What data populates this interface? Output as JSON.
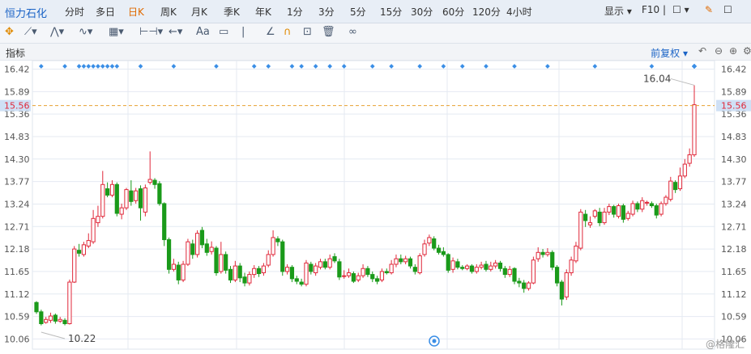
{
  "header": {
    "stock_name": "恒力石化",
    "periods": [
      "分时",
      "多日",
      "日K",
      "周K",
      "月K",
      "季K",
      "年K",
      "1分",
      "3分",
      "5分",
      "15分",
      "30分",
      "60分",
      "120分",
      "4小时"
    ],
    "active_period": "日K",
    "display_label": "显示",
    "f10_label": "F10"
  },
  "indicator_bar": {
    "label": "指标",
    "restore_label": "前复权"
  },
  "watermark": "@格隆汇",
  "colors": {
    "up": "#e0283a",
    "down": "#1a9a1a",
    "grid": "#e4eaf2",
    "marker": "#3a8ee6",
    "price_line": "#e8a030",
    "price_tag": "#cfe0f5"
  },
  "chart_data": {
    "type": "candlestick",
    "yticks": [
      16.42,
      15.89,
      15.36,
      14.83,
      14.3,
      13.77,
      13.24,
      12.71,
      12.18,
      11.65,
      11.12,
      10.59,
      10.06
    ],
    "ylim": [
      9.82,
      16.62
    ],
    "current_price": 15.56,
    "max_label": "16.04",
    "min_label": "10.22",
    "candles": [
      [
        10.92,
        10.7,
        10.95,
        10.65
      ],
      [
        10.7,
        10.42,
        10.75,
        10.38
      ],
      [
        10.45,
        10.52,
        10.58,
        10.42
      ],
      [
        10.5,
        10.6,
        10.68,
        10.44
      ],
      [
        10.62,
        10.48,
        10.66,
        10.42
      ],
      [
        10.48,
        10.52,
        10.58,
        10.44
      ],
      [
        10.5,
        10.42,
        10.55,
        10.38
      ],
      [
        10.42,
        11.4,
        11.46,
        10.4
      ],
      [
        11.4,
        12.18,
        12.25,
        11.38
      ],
      [
        12.15,
        12.08,
        12.3,
        12.0
      ],
      [
        12.05,
        12.28,
        12.35,
        12.0
      ],
      [
        12.25,
        12.38,
        12.55,
        12.2
      ],
      [
        12.35,
        12.9,
        13.1,
        12.3
      ],
      [
        12.8,
        12.95,
        13.2,
        12.7
      ],
      [
        12.95,
        13.7,
        14.02,
        12.9
      ],
      [
        13.6,
        13.45,
        13.75,
        13.4
      ],
      [
        13.45,
        13.7,
        13.8,
        13.4
      ],
      [
        13.7,
        13.02,
        13.75,
        12.95
      ],
      [
        13.0,
        13.15,
        13.25,
        12.88
      ],
      [
        13.15,
        13.58,
        13.62,
        13.1
      ],
      [
        13.55,
        13.3,
        13.8,
        13.2
      ],
      [
        13.32,
        13.55,
        13.62,
        13.25
      ],
      [
        13.6,
        13.15,
        13.68,
        12.85
      ],
      [
        13.05,
        13.62,
        13.7,
        12.95
      ],
      [
        13.75,
        13.82,
        14.48,
        13.7
      ],
      [
        13.8,
        13.7,
        13.85,
        13.6
      ],
      [
        13.72,
        13.25,
        13.78,
        13.2
      ],
      [
        13.25,
        12.4,
        13.28,
        12.25
      ],
      [
        12.4,
        11.7,
        12.45,
        11.6
      ],
      [
        11.7,
        11.82,
        11.95,
        11.65
      ],
      [
        11.8,
        11.45,
        11.88,
        11.35
      ],
      [
        11.45,
        11.82,
        11.9,
        11.4
      ],
      [
        11.82,
        12.35,
        12.42,
        11.78
      ],
      [
        12.3,
        12.05,
        12.4,
        11.95
      ],
      [
        12.05,
        12.55,
        12.62,
        11.98
      ],
      [
        12.62,
        12.28,
        12.7,
        12.2
      ],
      [
        12.3,
        12.1,
        12.42,
        12.02
      ],
      [
        12.12,
        12.22,
        12.36,
        12.05
      ],
      [
        12.2,
        11.62,
        12.25,
        11.55
      ],
      [
        11.65,
        12.05,
        12.35,
        11.6
      ],
      [
        12.05,
        11.68,
        12.12,
        11.6
      ],
      [
        11.7,
        11.45,
        11.78,
        11.38
      ],
      [
        11.45,
        11.78,
        11.9,
        11.4
      ],
      [
        11.78,
        11.5,
        11.85,
        11.4
      ],
      [
        11.52,
        11.38,
        11.62,
        11.3
      ],
      [
        11.38,
        11.58,
        11.65,
        11.32
      ],
      [
        11.58,
        11.72,
        11.8,
        11.5
      ],
      [
        11.72,
        11.6,
        11.78,
        11.52
      ],
      [
        11.62,
        11.78,
        11.85,
        11.55
      ],
      [
        11.8,
        12.05,
        12.15,
        11.75
      ],
      [
        12.05,
        12.45,
        12.62,
        12.0
      ],
      [
        12.42,
        12.35,
        12.48,
        12.25
      ],
      [
        12.35,
        11.65,
        12.4,
        11.55
      ],
      [
        11.65,
        11.75,
        11.82,
        11.58
      ],
      [
        11.75,
        11.48,
        11.8,
        11.4
      ],
      [
        11.48,
        11.42,
        11.55,
        11.35
      ],
      [
        11.4,
        11.35,
        11.48,
        11.3
      ],
      [
        11.35,
        11.85,
        11.92,
        11.3
      ],
      [
        11.82,
        11.65,
        11.88,
        11.58
      ],
      [
        11.62,
        11.78,
        11.85,
        11.55
      ],
      [
        11.75,
        11.88,
        11.95,
        11.7
      ],
      [
        11.88,
        11.75,
        11.95,
        11.7
      ],
      [
        11.75,
        11.95,
        12.05,
        11.7
      ],
      [
        12.0,
        11.9,
        12.08,
        11.85
      ],
      [
        11.88,
        11.52,
        11.95,
        11.45
      ],
      [
        11.55,
        11.55,
        11.68,
        11.48
      ],
      [
        11.55,
        11.62,
        11.72,
        11.5
      ],
      [
        11.6,
        11.42,
        11.65,
        11.38
      ],
      [
        11.45,
        11.55,
        11.62,
        11.4
      ],
      [
        11.55,
        11.72,
        11.82,
        11.5
      ],
      [
        11.72,
        11.58,
        11.78,
        11.52
      ],
      [
        11.58,
        11.48,
        11.65,
        11.4
      ],
      [
        11.48,
        11.42,
        11.55,
        11.35
      ],
      [
        11.45,
        11.65,
        11.72,
        11.4
      ],
      [
        11.65,
        11.62,
        11.72,
        11.58
      ],
      [
        11.62,
        11.82,
        11.92,
        11.58
      ],
      [
        11.82,
        11.95,
        12.05,
        11.75
      ],
      [
        11.95,
        11.88,
        12.05,
        11.82
      ],
      [
        11.88,
        11.95,
        12.02,
        11.82
      ],
      [
        11.95,
        11.78,
        12.0,
        11.72
      ],
      [
        11.75,
        11.65,
        11.82,
        11.58
      ],
      [
        11.62,
        12.02,
        12.08,
        11.58
      ],
      [
        12.05,
        12.3,
        12.4,
        12.0
      ],
      [
        12.32,
        12.45,
        12.52,
        12.25
      ],
      [
        12.42,
        12.2,
        12.48,
        12.15
      ],
      [
        12.2,
        12.1,
        12.28,
        12.05
      ],
      [
        12.12,
        12.05,
        12.22,
        12.0
      ],
      [
        12.05,
        11.68,
        12.08,
        11.62
      ],
      [
        11.7,
        11.9,
        11.98,
        11.62
      ],
      [
        11.88,
        11.75,
        11.95,
        11.7
      ],
      [
        11.75,
        11.72,
        11.8,
        11.68
      ],
      [
        11.72,
        11.78,
        11.82,
        11.68
      ],
      [
        11.78,
        11.65,
        11.82,
        11.6
      ],
      [
        11.65,
        11.75,
        11.82,
        11.6
      ],
      [
        11.75,
        11.8,
        11.88,
        11.7
      ],
      [
        11.82,
        11.7,
        11.9,
        11.65
      ],
      [
        11.7,
        11.78,
        11.88,
        11.65
      ],
      [
        11.78,
        11.85,
        11.92,
        11.72
      ],
      [
        11.85,
        11.72,
        11.9,
        11.65
      ],
      [
        11.72,
        11.58,
        11.78,
        11.5
      ],
      [
        11.58,
        11.7,
        11.78,
        11.52
      ],
      [
        11.72,
        11.42,
        11.75,
        11.35
      ],
      [
        11.42,
        11.38,
        11.5,
        11.28
      ],
      [
        11.38,
        11.25,
        11.45,
        11.15
      ],
      [
        11.25,
        11.38,
        11.42,
        11.2
      ],
      [
        11.38,
        11.92,
        12.0,
        11.35
      ],
      [
        11.95,
        12.1,
        12.22,
        11.88
      ],
      [
        12.1,
        12.05,
        12.18,
        11.98
      ],
      [
        12.05,
        12.1,
        12.2,
        12.0
      ],
      [
        12.1,
        11.75,
        12.15,
        11.68
      ],
      [
        11.75,
        11.38,
        11.8,
        11.3
      ],
      [
        11.4,
        11.0,
        11.45,
        10.85
      ],
      [
        11.05,
        11.62,
        11.7,
        10.98
      ],
      [
        11.62,
        11.92,
        12.0,
        11.55
      ],
      [
        11.9,
        12.25,
        12.35,
        11.85
      ],
      [
        12.2,
        13.05,
        13.12,
        12.15
      ],
      [
        13.0,
        12.85,
        13.1,
        12.7
      ],
      [
        12.75,
        12.8,
        12.95,
        12.68
      ],
      [
        12.95,
        13.08,
        13.12,
        12.9
      ],
      [
        13.05,
        12.8,
        13.15,
        12.72
      ],
      [
        12.8,
        13.05,
        13.15,
        12.75
      ],
      [
        13.05,
        13.18,
        13.25,
        12.98
      ],
      [
        13.18,
        13.0,
        13.22,
        12.92
      ],
      [
        12.95,
        13.2,
        13.25,
        12.9
      ],
      [
        13.2,
        12.88,
        13.25,
        12.8
      ],
      [
        12.9,
        13.02,
        13.08,
        12.85
      ],
      [
        13.0,
        13.25,
        13.32,
        12.95
      ],
      [
        13.25,
        13.12,
        13.3,
        13.05
      ],
      [
        13.12,
        13.32,
        13.4,
        13.05
      ],
      [
        13.28,
        13.28,
        13.32,
        13.2
      ],
      [
        13.25,
        13.2,
        13.3,
        13.15
      ],
      [
        13.2,
        12.98,
        13.25,
        12.9
      ],
      [
        13.0,
        13.25,
        13.3,
        12.95
      ],
      [
        13.25,
        13.4,
        13.45,
        13.2
      ],
      [
        13.35,
        13.78,
        13.88,
        13.3
      ],
      [
        13.75,
        13.58,
        13.8,
        13.5
      ],
      [
        13.6,
        13.9,
        14.1,
        13.55
      ],
      [
        13.9,
        14.18,
        14.3,
        13.85
      ],
      [
        14.2,
        14.4,
        14.55,
        14.12
      ],
      [
        14.4,
        15.58,
        16.04,
        14.35
      ]
    ],
    "markers": [
      1,
      6,
      9,
      10,
      11,
      12,
      13,
      14,
      15,
      16,
      17,
      22,
      29,
      38,
      46,
      49,
      54,
      56,
      59,
      62,
      65,
      71,
      75,
      81,
      86,
      90,
      95,
      101,
      108,
      118,
      130,
      141,
      143,
      150,
      151,
      152,
      154,
      156,
      157,
      159,
      163,
      164,
      168
    ]
  }
}
